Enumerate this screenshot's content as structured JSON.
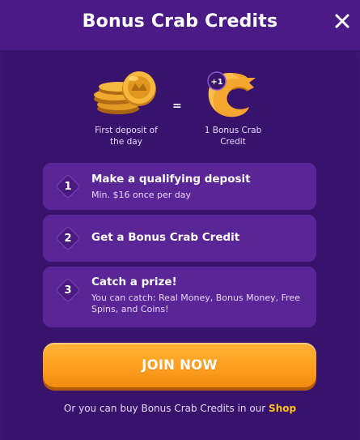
{
  "modal": {
    "title": "Bonus Crab Credits",
    "close_icon": "close-icon"
  },
  "exchange": {
    "left_caption": "First deposit of the day",
    "equals": "=",
    "right_caption": "1 Bonus Crab Credit",
    "badge_text": "+1"
  },
  "steps": [
    {
      "number": "1",
      "title": "Make a qualifying deposit",
      "desc": "Min. $16 once per day"
    },
    {
      "number": "2",
      "title": "Get a Bonus Crab Credit",
      "desc": ""
    },
    {
      "number": "3",
      "title": "Catch a prize!",
      "desc": "You can catch: Real Money, Bonus Money, Free Spins, and Coins!"
    }
  ],
  "cta": {
    "label": "JOIN NOW"
  },
  "footer": {
    "text": "Or you can buy Bonus Crab Credits in our",
    "link": "Shop"
  },
  "colors": {
    "background": "#3c1570",
    "card": "#5a2597",
    "accent_orange": "#ff9f1f",
    "link_yellow": "#ffc21a"
  }
}
